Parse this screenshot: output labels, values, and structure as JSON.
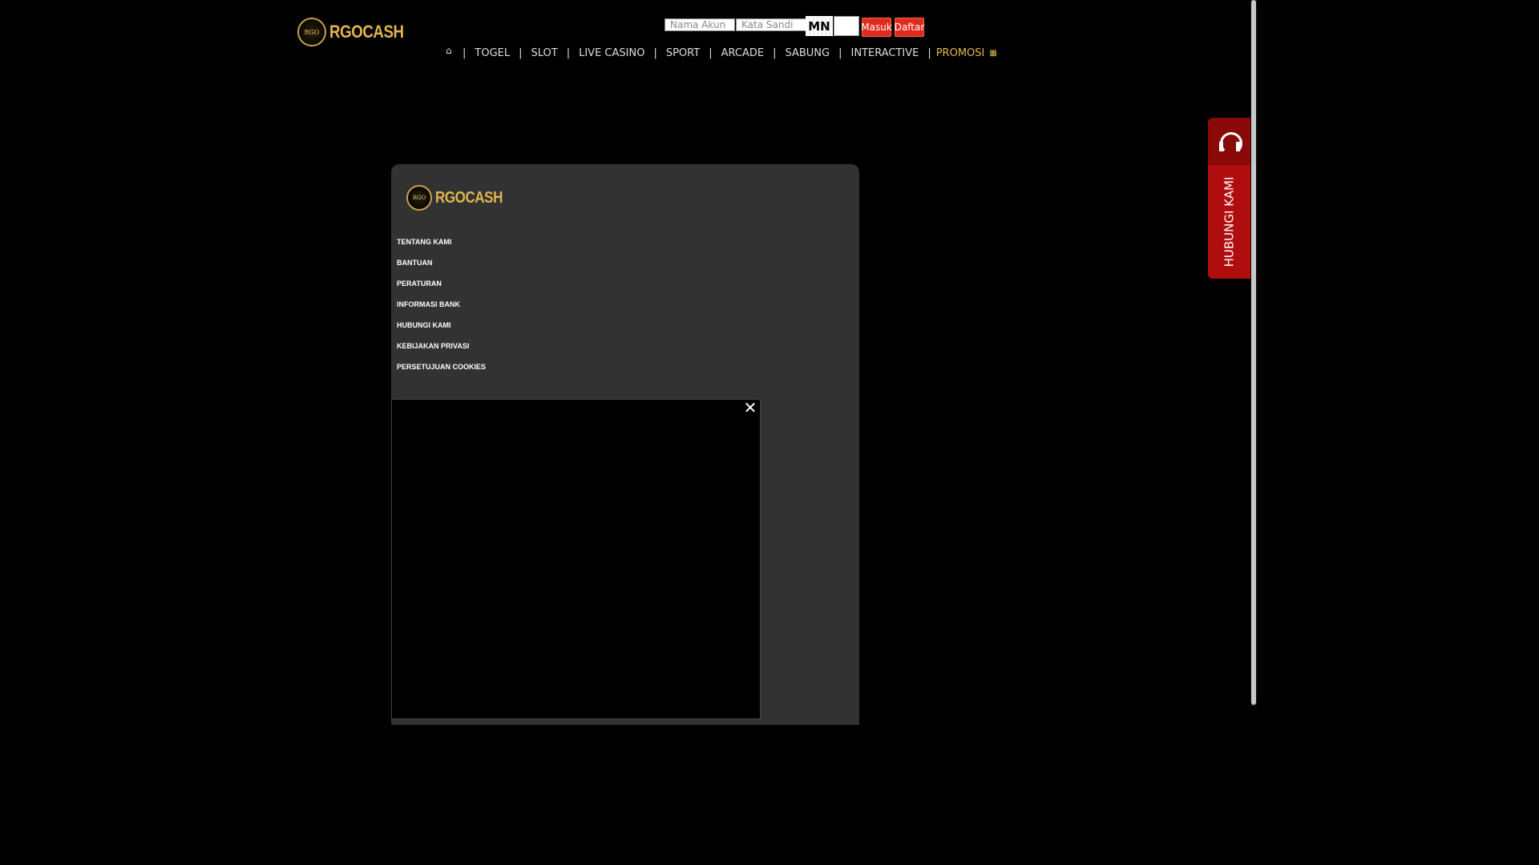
{
  "brand": {
    "name": "RGOCASH",
    "emblem_text": "RGO"
  },
  "login": {
    "username_placeholder": "Nama Akun",
    "password_placeholder": "Kata Sandi",
    "captcha": "MN",
    "login_label": "Masuk",
    "register_label": "Daftar"
  },
  "nav": {
    "items": [
      "TOGEL",
      "SLOT",
      "LIVE CASINO",
      "SPORT",
      "ARCADE",
      "SABUNG",
      "INTERACTIVE"
    ],
    "promo": "PROMOSI"
  },
  "footer_links": [
    "TENTANG KAMI",
    "BANTUAN",
    "PERATURAN",
    "INFORMASI BANK",
    "HUBUNGI KAMI",
    "KEBIJAKAN PRIVASI",
    "PERSETUJUAN COOKIES"
  ],
  "contact": {
    "label": "HUBUNGI KAMI",
    "icon": "headset-icon"
  },
  "popup": {
    "close_icon": "close-icon"
  },
  "colors": {
    "accent_gold": "#e1b54f",
    "button_red": "#e02a1b",
    "card_bg": "#323232",
    "contact_red": "#b00e0e"
  }
}
